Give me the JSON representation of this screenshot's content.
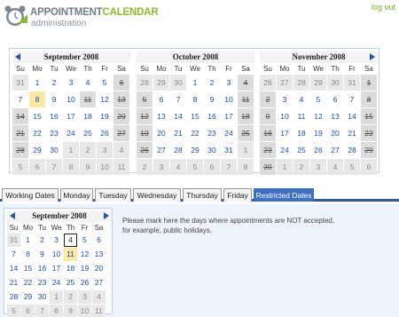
{
  "header": {
    "logo_word1": "APPOINTMENT",
    "logo_word2": "CALENDAR",
    "logo_sub": "administration",
    "logout": "log out"
  },
  "days_of_week": [
    "Su",
    "Mo",
    "Tu",
    "We",
    "Th",
    "Fr",
    "Sa"
  ],
  "calendars": [
    {
      "title": "September 2008",
      "weeks": [
        [
          "31",
          "1",
          "2",
          "3",
          "4",
          "5",
          "6"
        ],
        [
          "7",
          "8",
          "9",
          "10",
          "11",
          "12",
          "13"
        ],
        [
          "14",
          "15",
          "16",
          "17",
          "18",
          "19",
          "20"
        ],
        [
          "21",
          "22",
          "23",
          "24",
          "25",
          "26",
          "27"
        ],
        [
          "28",
          "29",
          "30",
          "1",
          "2",
          "3",
          "4"
        ],
        [
          "5",
          "6",
          "7",
          "8",
          "9",
          "10",
          "11"
        ]
      ]
    },
    {
      "title": "October 2008",
      "weeks": [
        [
          "28",
          "29",
          "30",
          "1",
          "2",
          "3",
          "4"
        ],
        [
          "5",
          "6",
          "7",
          "8",
          "9",
          "10",
          "11"
        ],
        [
          "12",
          "13",
          "14",
          "15",
          "16",
          "17",
          "18"
        ],
        [
          "19",
          "20",
          "21",
          "22",
          "23",
          "24",
          "25"
        ],
        [
          "26",
          "27",
          "28",
          "29",
          "30",
          "31",
          "1"
        ],
        [
          "2",
          "3",
          "4",
          "5",
          "6",
          "7",
          "8"
        ]
      ]
    },
    {
      "title": "November 2008",
      "weeks": [
        [
          "26",
          "27",
          "28",
          "29",
          "30",
          "31",
          "1"
        ],
        [
          "2",
          "3",
          "4",
          "5",
          "6",
          "7",
          "8"
        ],
        [
          "9",
          "10",
          "11",
          "12",
          "13",
          "14",
          "15"
        ],
        [
          "16",
          "17",
          "18",
          "19",
          "20",
          "21",
          "22"
        ],
        [
          "23",
          "24",
          "25",
          "26",
          "27",
          "28",
          "29"
        ],
        [
          "30",
          "1",
          "2",
          "3",
          "4",
          "5",
          "6"
        ]
      ]
    }
  ],
  "tabs": [
    "Working Dates",
    "Monday",
    "Tuesday",
    "Wednesday",
    "Thursday",
    "Friday",
    "Restricted Dates"
  ],
  "active_tab": "Restricted Dates",
  "small_calendar": {
    "title": "September 2008",
    "weeks": [
      [
        "31",
        "1",
        "2",
        "3",
        "4",
        "5",
        "6"
      ],
      [
        "7",
        "8",
        "9",
        "10",
        "11",
        "12",
        "13"
      ],
      [
        "14",
        "15",
        "16",
        "17",
        "18",
        "19",
        "20"
      ],
      [
        "21",
        "22",
        "23",
        "24",
        "25",
        "26",
        "27"
      ],
      [
        "28",
        "29",
        "30",
        "1",
        "2",
        "3",
        "4"
      ],
      [
        "5",
        "6",
        "7",
        "8",
        "9",
        "10",
        "11"
      ]
    ]
  },
  "message_line1": "Please mark here the days where appointments are NOT accepted,",
  "message_line2": "for example, public holidays.",
  "colors": {
    "accent": "#2c59a8",
    "link": "#1b4ea0",
    "brand_green": "#8dbb2c",
    "today": "#fce9a3"
  }
}
